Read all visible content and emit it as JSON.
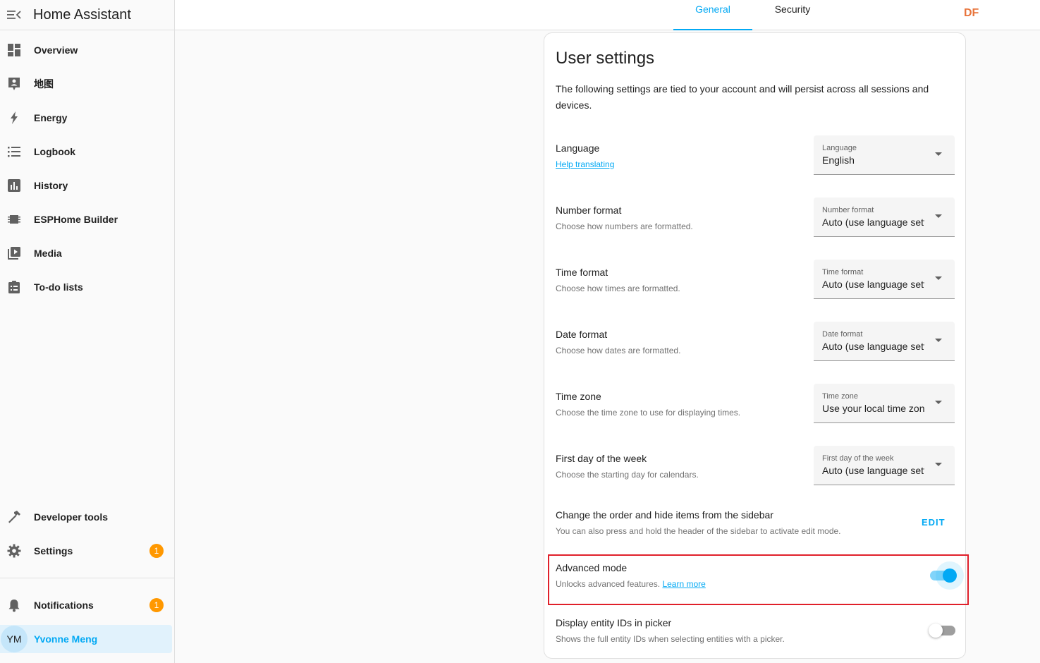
{
  "app": {
    "title": "Home Assistant"
  },
  "sidebar": {
    "items": [
      {
        "label": "Overview",
        "icon": "dashboard-icon"
      },
      {
        "label": "地图",
        "icon": "map-account-icon"
      },
      {
        "label": "Energy",
        "icon": "lightning-bolt-icon"
      },
      {
        "label": "Logbook",
        "icon": "list-icon"
      },
      {
        "label": "History",
        "icon": "chart-box-icon"
      },
      {
        "label": "ESPHome Builder",
        "icon": "chip-icon"
      },
      {
        "label": "Media",
        "icon": "play-box-multiple-icon"
      },
      {
        "label": "To-do lists",
        "icon": "clipboard-list-icon"
      }
    ],
    "developer_tools": {
      "label": "Developer tools",
      "icon": "hammer-icon"
    },
    "settings": {
      "label": "Settings",
      "icon": "gear-icon",
      "badge": "1"
    },
    "notifications": {
      "label": "Notifications",
      "icon": "bell-icon",
      "badge": "1"
    },
    "user": {
      "initials": "YM",
      "name": "Yvonne Meng"
    }
  },
  "tabs": [
    {
      "label": "General",
      "active": true
    },
    {
      "label": "Security",
      "active": false
    }
  ],
  "brand_logo": "DF",
  "card": {
    "title": "User settings",
    "description": "The following settings are tied to your account and will persist across all sessions and devices.",
    "language": {
      "title": "Language",
      "link": "Help translating",
      "select_label": "Language",
      "select_value": "English"
    },
    "number_format": {
      "title": "Number format",
      "subtitle": "Choose how numbers are formatted.",
      "select_label": "Number format",
      "select_value": "Auto (use language setting)"
    },
    "time_format": {
      "title": "Time format",
      "subtitle": "Choose how times are formatted.",
      "select_label": "Time format",
      "select_value": "Auto (use language setting)"
    },
    "date_format": {
      "title": "Date format",
      "subtitle": "Choose how dates are formatted.",
      "select_label": "Date format",
      "select_value": "Auto (use language setting)"
    },
    "time_zone": {
      "title": "Time zone",
      "subtitle": "Choose the time zone to use for displaying times.",
      "select_label": "Time zone",
      "select_value": "Use your local time zone"
    },
    "first_day": {
      "title": "First day of the week",
      "subtitle": "Choose the starting day for calendars.",
      "select_label": "First day of the week",
      "select_value": "Auto (use language setting)"
    },
    "sidebar_order": {
      "title": "Change the order and hide items from the sidebar",
      "subtitle": "You can also press and hold the header of the sidebar to activate edit mode.",
      "button": "EDIT"
    },
    "advanced_mode": {
      "title": "Advanced mode",
      "subtitle": "Unlocks advanced features.",
      "link": "Learn more",
      "enabled": true
    },
    "entity_ids": {
      "title": "Display entity IDs in picker",
      "subtitle": "Shows the full entity IDs when selecting entities with a picker.",
      "enabled": false
    }
  },
  "colors": {
    "accent": "#03a9f4",
    "badge": "#ff9800",
    "highlight": "#e0202a"
  }
}
